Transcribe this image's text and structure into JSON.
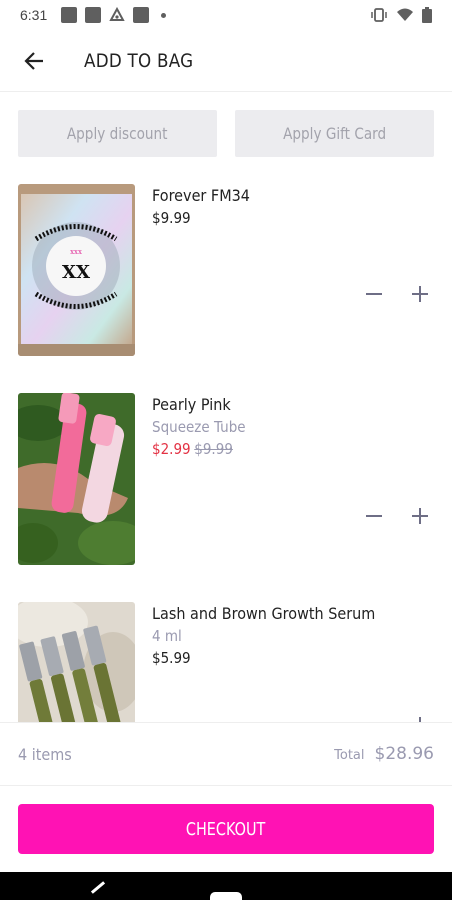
{
  "status_bar": {
    "time": "6:31"
  },
  "header": {
    "title": "ADD TO BAG"
  },
  "actions": {
    "discount_label": "Apply discount",
    "gift_card_label": "Apply Gift Card"
  },
  "items": [
    {
      "name": "Forever FM34",
      "price": "$9.99"
    },
    {
      "name": "Pearly Pink",
      "variant": "Squeeze Tube",
      "sale_price": "$2.99",
      "original_price": "$9.99"
    },
    {
      "name": "Lash and Brown Growth Serum",
      "variant": "4 ml",
      "price": "$5.99"
    }
  ],
  "summary": {
    "count": "4 items",
    "total_label": "Total",
    "total_value": "$28.96"
  },
  "checkout": {
    "label": "CHECKOUT"
  },
  "colors": {
    "accent": "#ff12b4",
    "sale": "#e33244",
    "muted": "#9a9ab0"
  }
}
